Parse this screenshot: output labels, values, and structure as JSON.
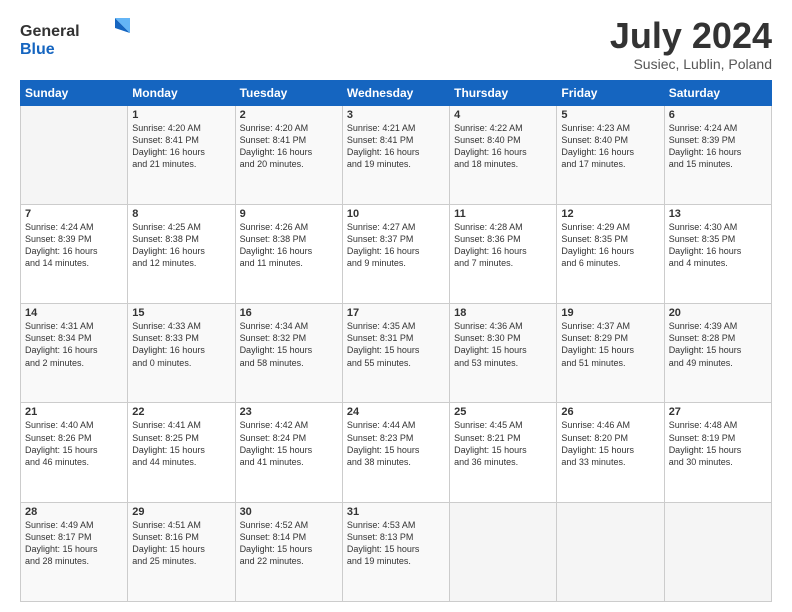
{
  "header": {
    "logo_general": "General",
    "logo_blue": "Blue",
    "month_title": "July 2024",
    "subtitle": "Susiec, Lublin, Poland"
  },
  "weekdays": [
    "Sunday",
    "Monday",
    "Tuesday",
    "Wednesday",
    "Thursday",
    "Friday",
    "Saturday"
  ],
  "weeks": [
    [
      {
        "day": "",
        "info": ""
      },
      {
        "day": "1",
        "info": "Sunrise: 4:20 AM\nSunset: 8:41 PM\nDaylight: 16 hours\nand 21 minutes."
      },
      {
        "day": "2",
        "info": "Sunrise: 4:20 AM\nSunset: 8:41 PM\nDaylight: 16 hours\nand 20 minutes."
      },
      {
        "day": "3",
        "info": "Sunrise: 4:21 AM\nSunset: 8:41 PM\nDaylight: 16 hours\nand 19 minutes."
      },
      {
        "day": "4",
        "info": "Sunrise: 4:22 AM\nSunset: 8:40 PM\nDaylight: 16 hours\nand 18 minutes."
      },
      {
        "day": "5",
        "info": "Sunrise: 4:23 AM\nSunset: 8:40 PM\nDaylight: 16 hours\nand 17 minutes."
      },
      {
        "day": "6",
        "info": "Sunrise: 4:24 AM\nSunset: 8:39 PM\nDaylight: 16 hours\nand 15 minutes."
      }
    ],
    [
      {
        "day": "7",
        "info": "Sunrise: 4:24 AM\nSunset: 8:39 PM\nDaylight: 16 hours\nand 14 minutes."
      },
      {
        "day": "8",
        "info": "Sunrise: 4:25 AM\nSunset: 8:38 PM\nDaylight: 16 hours\nand 12 minutes."
      },
      {
        "day": "9",
        "info": "Sunrise: 4:26 AM\nSunset: 8:38 PM\nDaylight: 16 hours\nand 11 minutes."
      },
      {
        "day": "10",
        "info": "Sunrise: 4:27 AM\nSunset: 8:37 PM\nDaylight: 16 hours\nand 9 minutes."
      },
      {
        "day": "11",
        "info": "Sunrise: 4:28 AM\nSunset: 8:36 PM\nDaylight: 16 hours\nand 7 minutes."
      },
      {
        "day": "12",
        "info": "Sunrise: 4:29 AM\nSunset: 8:35 PM\nDaylight: 16 hours\nand 6 minutes."
      },
      {
        "day": "13",
        "info": "Sunrise: 4:30 AM\nSunset: 8:35 PM\nDaylight: 16 hours\nand 4 minutes."
      }
    ],
    [
      {
        "day": "14",
        "info": "Sunrise: 4:31 AM\nSunset: 8:34 PM\nDaylight: 16 hours\nand 2 minutes."
      },
      {
        "day": "15",
        "info": "Sunrise: 4:33 AM\nSunset: 8:33 PM\nDaylight: 16 hours\nand 0 minutes."
      },
      {
        "day": "16",
        "info": "Sunrise: 4:34 AM\nSunset: 8:32 PM\nDaylight: 15 hours\nand 58 minutes."
      },
      {
        "day": "17",
        "info": "Sunrise: 4:35 AM\nSunset: 8:31 PM\nDaylight: 15 hours\nand 55 minutes."
      },
      {
        "day": "18",
        "info": "Sunrise: 4:36 AM\nSunset: 8:30 PM\nDaylight: 15 hours\nand 53 minutes."
      },
      {
        "day": "19",
        "info": "Sunrise: 4:37 AM\nSunset: 8:29 PM\nDaylight: 15 hours\nand 51 minutes."
      },
      {
        "day": "20",
        "info": "Sunrise: 4:39 AM\nSunset: 8:28 PM\nDaylight: 15 hours\nand 49 minutes."
      }
    ],
    [
      {
        "day": "21",
        "info": "Sunrise: 4:40 AM\nSunset: 8:26 PM\nDaylight: 15 hours\nand 46 minutes."
      },
      {
        "day": "22",
        "info": "Sunrise: 4:41 AM\nSunset: 8:25 PM\nDaylight: 15 hours\nand 44 minutes."
      },
      {
        "day": "23",
        "info": "Sunrise: 4:42 AM\nSunset: 8:24 PM\nDaylight: 15 hours\nand 41 minutes."
      },
      {
        "day": "24",
        "info": "Sunrise: 4:44 AM\nSunset: 8:23 PM\nDaylight: 15 hours\nand 38 minutes."
      },
      {
        "day": "25",
        "info": "Sunrise: 4:45 AM\nSunset: 8:21 PM\nDaylight: 15 hours\nand 36 minutes."
      },
      {
        "day": "26",
        "info": "Sunrise: 4:46 AM\nSunset: 8:20 PM\nDaylight: 15 hours\nand 33 minutes."
      },
      {
        "day": "27",
        "info": "Sunrise: 4:48 AM\nSunset: 8:19 PM\nDaylight: 15 hours\nand 30 minutes."
      }
    ],
    [
      {
        "day": "28",
        "info": "Sunrise: 4:49 AM\nSunset: 8:17 PM\nDaylight: 15 hours\nand 28 minutes."
      },
      {
        "day": "29",
        "info": "Sunrise: 4:51 AM\nSunset: 8:16 PM\nDaylight: 15 hours\nand 25 minutes."
      },
      {
        "day": "30",
        "info": "Sunrise: 4:52 AM\nSunset: 8:14 PM\nDaylight: 15 hours\nand 22 minutes."
      },
      {
        "day": "31",
        "info": "Sunrise: 4:53 AM\nSunset: 8:13 PM\nDaylight: 15 hours\nand 19 minutes."
      },
      {
        "day": "",
        "info": ""
      },
      {
        "day": "",
        "info": ""
      },
      {
        "day": "",
        "info": ""
      }
    ]
  ]
}
